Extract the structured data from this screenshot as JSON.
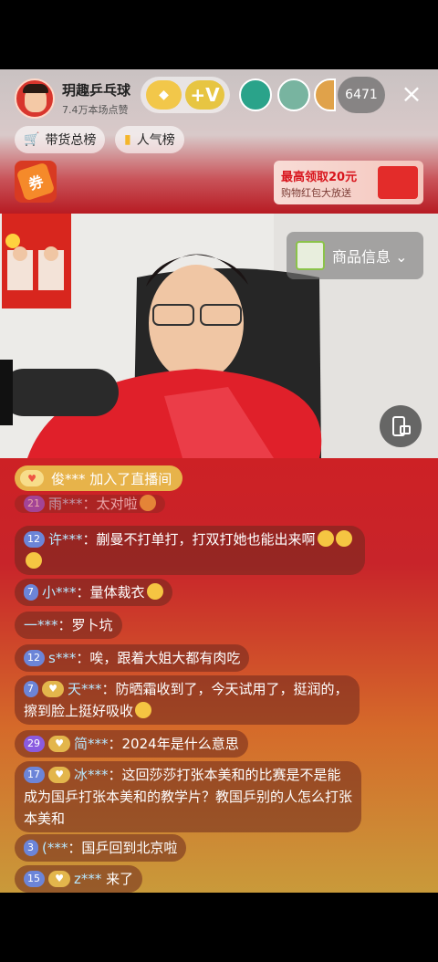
{
  "header": {
    "host_name": "玥趣乒乓球",
    "host_sub": "7.4万本场点赞",
    "viewer_count": "6471",
    "close_icon": "×",
    "follow_v": "+V"
  },
  "chips": {
    "goods": "带货总榜",
    "popular": "人气榜"
  },
  "coupon": {
    "label": "券"
  },
  "redpack": {
    "title": "最高领取20元",
    "sub": "购物红包大放送"
  },
  "product": {
    "label": "商品信息 ⌄"
  },
  "chat": {
    "joined": "俊*** 加入了直播间",
    "messages": [
      {
        "level": "21",
        "user": "雨***",
        "text": "：太对啦"
      },
      {
        "level": "12",
        "user": "许***",
        "text": "：蒯曼不打单打，打双打她也能出来啊"
      },
      {
        "level": "7",
        "user": "小***",
        "text": "：量体裁衣"
      },
      {
        "level": "",
        "user": "一***",
        "text": "：罗卜坑"
      },
      {
        "level": "12",
        "user": "s***",
        "text": "：唉，跟着大姐大都有肉吃"
      },
      {
        "level": "7",
        "user": "天***",
        "text": "：防晒霜收到了，今天试用了，挺润的，擦到脸上挺好吸收"
      },
      {
        "level": "29",
        "user": "简***",
        "text": "：2024年是什么意思"
      },
      {
        "level": "17",
        "user": "冰***",
        "text": "：这回莎莎打张本美和的比赛是不是能成为国乒打张本美和的教学片？教国乒别的人怎么打张本美和"
      },
      {
        "level": "3",
        "user": "(***",
        "text": "：国乒回到北京啦"
      },
      {
        "level": "15",
        "user": "z***",
        "text": " 来了"
      }
    ]
  }
}
